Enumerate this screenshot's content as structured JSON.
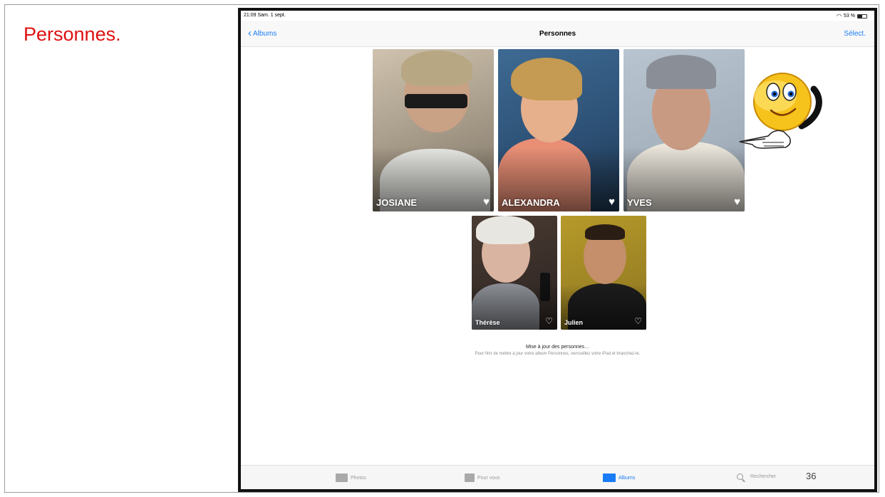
{
  "slide": {
    "title": "Personnes.",
    "page_number": "36"
  },
  "status_bar": {
    "time": "21:09  Sam. 1 sept.",
    "battery": "53 %"
  },
  "nav": {
    "back_label": "Albums",
    "title": "Personnes",
    "select_label": "Sélect."
  },
  "people": [
    {
      "name": "JOSIANE",
      "favorite": true
    },
    {
      "name": "ALEXANDRA",
      "favorite": true
    },
    {
      "name": "YVES",
      "favorite": true
    },
    {
      "name": "Thérèse",
      "favorite": false
    },
    {
      "name": "Julien",
      "favorite": false
    }
  ],
  "update": {
    "title": "Mise à jour des personnes…",
    "subtitle": "Pour finir de mettre à jour votre album Personnes, verrouillez votre iPad et branchez-le."
  },
  "tabs": [
    {
      "label": "Photos",
      "active": false
    },
    {
      "label": "Pour vous",
      "active": false
    },
    {
      "label": "Albums",
      "active": true
    },
    {
      "label": "Rechercher",
      "active": false
    }
  ],
  "colors": {
    "title_red": "#e01010",
    "ios_blue": "#1a7cf5"
  }
}
